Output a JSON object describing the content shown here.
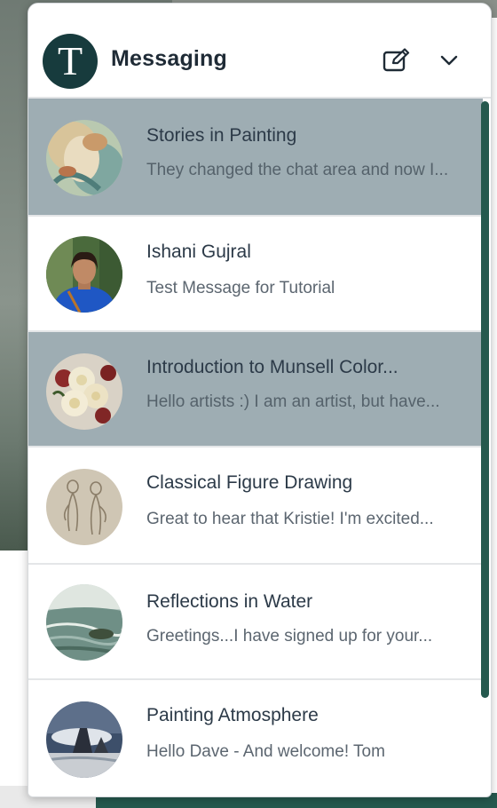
{
  "header": {
    "logo_letter": "T",
    "title": "Messaging",
    "icons": {
      "compose": "compose-icon",
      "collapse": "chevron-down-icon"
    }
  },
  "colors": {
    "accent": "#25594e",
    "logo_bg": "#173b3d",
    "highlight": "#9eadb3",
    "divider": "#e4e6e8"
  },
  "conversations": [
    {
      "name": "Stories in Painting",
      "preview": "They changed the chat area and now I...",
      "highlighted": true
    },
    {
      "name": "Ishani Gujral",
      "preview": "Test Message for Tutorial",
      "highlighted": false
    },
    {
      "name": "Introduction to Munsell Color...",
      "preview": "Hello artists :) I am an artist, but have...",
      "highlighted": true
    },
    {
      "name": "Classical Figure Drawing",
      "preview": "Great to hear that Kristie! I'm excited...",
      "highlighted": false
    },
    {
      "name": "Reflections in Water",
      "preview": "Greetings...I have signed up for your...",
      "highlighted": false
    },
    {
      "name": "Painting Atmosphere",
      "preview": "Hello Dave - And welcome!  Tom",
      "highlighted": false
    }
  ]
}
